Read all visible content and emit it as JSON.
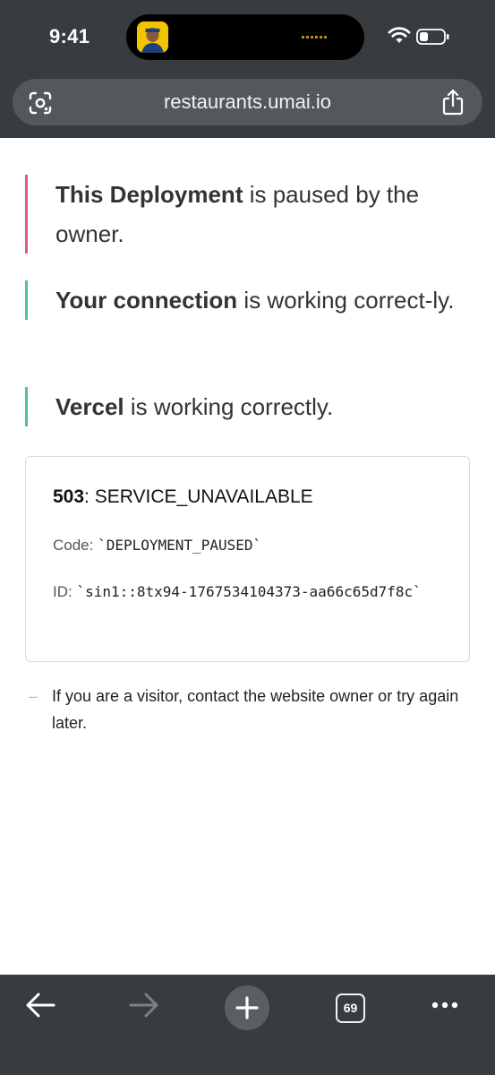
{
  "status_bar": {
    "time": "9:41"
  },
  "browser": {
    "url": "restaurants.umai.io"
  },
  "page": {
    "statuses": [
      {
        "bold": "This Deployment",
        "text": " is paused by the owner.",
        "color": "#e25a8a"
      },
      {
        "bold": "Your connection",
        "text": " is working correct-ly.",
        "color": "#52c19a"
      },
      {
        "bold": "Vercel",
        "text": " is working correctly.",
        "color": "#52c19a"
      }
    ],
    "error": {
      "code_number": "503",
      "code_name": ": SERVICE_UNAVAILABLE",
      "code_label": "Code: ",
      "code_value": "`DEPLOYMENT_PAUSED`",
      "id_label": "ID: ",
      "id_value": "`sin1::8tx94-1767534104373-aa66c65d7f8c`"
    },
    "help": {
      "dash": "–",
      "text": "If you are a visitor, contact the website owner or try again later."
    }
  },
  "toolbar": {
    "tab_count": "69"
  },
  "colors": {
    "chrome": "#383c3f",
    "url_bar": "#54585b",
    "paused": "#e25a8a",
    "ok": "#52c19a"
  }
}
